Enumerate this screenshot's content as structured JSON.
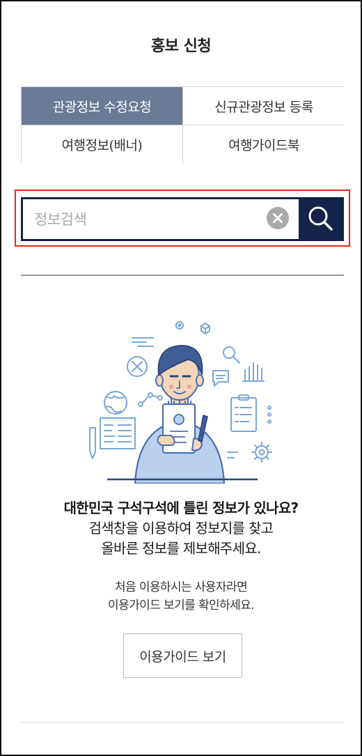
{
  "header": {
    "title": "홍보 신청"
  },
  "tabs": [
    {
      "label": "관광정보 수정요청",
      "active": true
    },
    {
      "label": "신규관광정보 등록",
      "active": false
    },
    {
      "label": "여행정보(배너)",
      "active": false
    },
    {
      "label": "여행가이드북",
      "active": false
    }
  ],
  "search": {
    "placeholder": "정보검색",
    "value": ""
  },
  "icons": {
    "clear": "clear-circle-x-icon",
    "search": "magnifier-icon"
  },
  "colors": {
    "active_tab": "#6b7a96",
    "search_border": "#13244a",
    "highlight": "#e0281e",
    "illustration_blue": "#7aa6d8"
  },
  "guide": {
    "headline_1": "대한민국 구석구석에 틀린 정보가 있나요?",
    "headline_2": "검색창을 이용하여 정보지를 찾고",
    "headline_3": "올바른 정보를 제보해주세요.",
    "sub_1": "처음 이용하시는 사용자라면",
    "sub_2": "이용가이드 보기를 확인하세요.",
    "button_label": "이용가이드 보기"
  }
}
